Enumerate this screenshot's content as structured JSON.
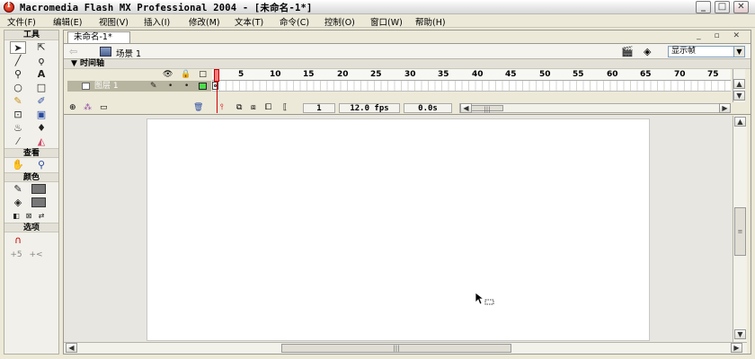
{
  "window": {
    "title": "Macromedia Flash MX Professional 2004 - [未命名-1*]",
    "buttons": [
      "_",
      "□",
      "✕"
    ]
  },
  "menubar": {
    "items": [
      "文件(F)",
      "编辑(E)",
      "视图(V)",
      "插入(I)",
      "修改(M)",
      "文本(T)",
      "命令(C)",
      "控制(O)",
      "窗口(W)",
      "帮助(H)"
    ]
  },
  "tools": {
    "header": "工具",
    "view_label": "查看",
    "color_label": "颜色",
    "options_label": "选项",
    "icons": [
      "arrow-icon",
      "subselect-icon",
      "line-icon",
      "lasso-icon",
      "pen-icon",
      "text-icon",
      "oval-icon",
      "rectangle-icon",
      "pencil-icon",
      "brush-icon",
      "free-transform-icon",
      "fill-transform-icon",
      "ink-bottle-icon",
      "paint-bucket-icon",
      "eyedropper-icon",
      "eraser-icon",
      "hand-icon",
      "zoom-icon",
      "stroke-color-icon",
      "fill-color-icon",
      "magnet-icon"
    ],
    "options_text": [
      "+5",
      "+<"
    ]
  },
  "document": {
    "tab_label": "未命名-1*",
    "scene_label": "场景 1",
    "zoom_value": "显示帧",
    "doc_controls": "_ ▫ ✕"
  },
  "timeline": {
    "header": "▼ 时间轴",
    "frame_numbers": [
      "1",
      "5",
      "10",
      "15",
      "20",
      "25",
      "30",
      "35",
      "40",
      "45",
      "50",
      "55",
      "60",
      "65",
      "70",
      "75"
    ],
    "layer_name": "图层 1",
    "current_frame": "1",
    "fps": "12.0 fps",
    "elapsed": "0.0s"
  },
  "colors": {
    "background": "#ece9d8",
    "stage": "#ffffff",
    "playhead": "#d00000",
    "layer_selected": "#b7b49f",
    "outline_swatch": "#4bdc4b"
  }
}
